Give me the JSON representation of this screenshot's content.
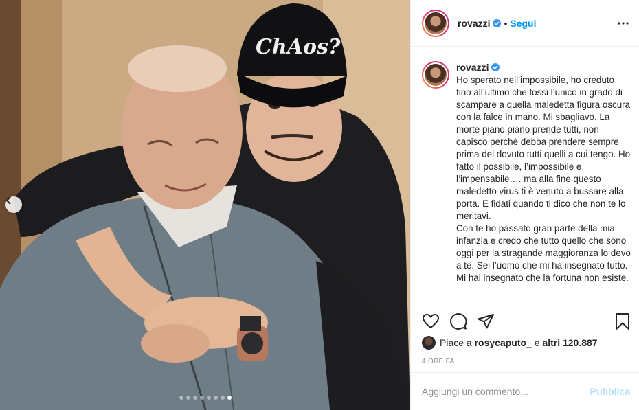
{
  "post": {
    "username": "rovazzi",
    "separator": "•",
    "follow_label": "Segui",
    "caption_username": "rovazzi",
    "caption": "Ho sperato nell’impossibile, ho creduto fino all’ultimo che fossi l’unico in grado di scampare a quella maledetta figura oscura con la falce in mano. Mi sbagliavo. La morte piano piano prende tutti, non capisco perchè debba prendere sempre prima del dovuto tutti quelli a cui tengo. Ho fatto il possibile, l’impossibile e l’impensabile…. ma alla fine questo maledetto virus ti è venuto a bussare alla porta. E fidati quando ti dico che non te lo meritavi.\nCon te ho passato gran parte della mia infanzia e credo che tutto quello che sono oggi per la stragande maggioranza lo devo a te. Sei l’uomo che mi ha insegnato tutto. Mi hai insegnato che la fortuna non esiste.",
    "likes_prefix": "Piace a ",
    "liked_by": "rosycaputo_",
    "likes_middle": " e ",
    "likes_count": "altri 120.887",
    "timestamp": "4 ORE FA"
  },
  "photo": {
    "cap_text": "ChAos?",
    "slide_count": 8,
    "active_slide": 8
  },
  "comment": {
    "placeholder": "Aggiungi un commento...",
    "publish_label": "Pubblica"
  },
  "colors": {
    "accent": "#0095f6",
    "publish_disabled": "#b2dffc",
    "muted": "#8e8e8e",
    "text": "#262626",
    "border": "#efefef"
  },
  "icons": [
    "chevron-left-icon",
    "verified-icon",
    "more-options-icon",
    "heart-icon",
    "comment-icon",
    "share-icon",
    "bookmark-icon"
  ]
}
